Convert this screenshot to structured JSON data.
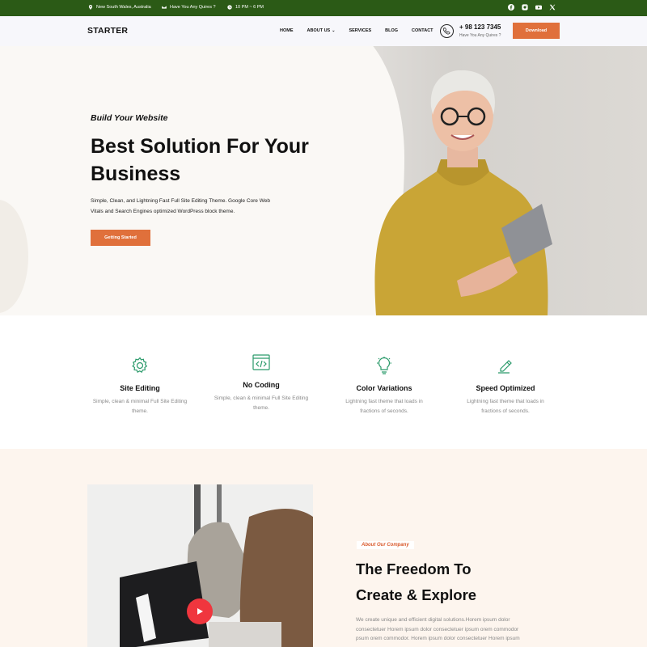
{
  "topbar": {
    "location": "New South Wales, Australia",
    "email": "Have You Any Quires ?",
    "hours": "10 PM ~ 6 PM",
    "socials": [
      "facebook-icon",
      "instagram-icon",
      "youtube-icon",
      "x-icon"
    ],
    "bg_color": "#2b5a16"
  },
  "header": {
    "logo": "STARTER",
    "nav": [
      "HOME",
      "ABOUT US",
      "SERVICES",
      "BLOG",
      "CONTACT"
    ],
    "phone": "+ 98 123 7345",
    "phone_sub": "Have You Any Quires ?",
    "download": "Download",
    "accent": "#e0703b"
  },
  "hero": {
    "eyebrow": "Build Your Website",
    "title_line1": "Best Solution For Your",
    "title_line2": "Business",
    "desc_line1": "Simple, Clean, and Lightning Fast Full Site Editing Theme. Google Core Web",
    "desc_line2": "Vitals and Search Engines optimized WordPress block theme.",
    "cta": "Getting Started"
  },
  "features": [
    {
      "icon": "gear-icon",
      "title": "Site Editing",
      "desc1": "Simple, clean & minimal Full Site Editing",
      "desc2": "theme."
    },
    {
      "icon": "code-icon",
      "title": "No Coding",
      "desc1": "Simple, clean & minimal Full Site Editing",
      "desc2": "theme."
    },
    {
      "icon": "lightbulb-icon",
      "title": "Color Variations",
      "desc1": "Lightning fast theme that loads in",
      "desc2": "fractions of seconds."
    },
    {
      "icon": "pen-icon",
      "title": "Speed Optimized",
      "desc1": "Lightning fast theme that loads in",
      "desc2": "fractions of seconds."
    }
  ],
  "about": {
    "tag": "About Our Company",
    "title_line1": "The Freedom To",
    "title_line2": "Create & Explore",
    "desc1": "We create unique and efficient digital solutions.Horem ipsum dolor",
    "desc2": "consectetuer Horem ipsum dolor consectetuer ipsum orem commodor",
    "desc3": "psum orem commodor. Horem ipsum dolor consectetuer Horem ipsum"
  }
}
